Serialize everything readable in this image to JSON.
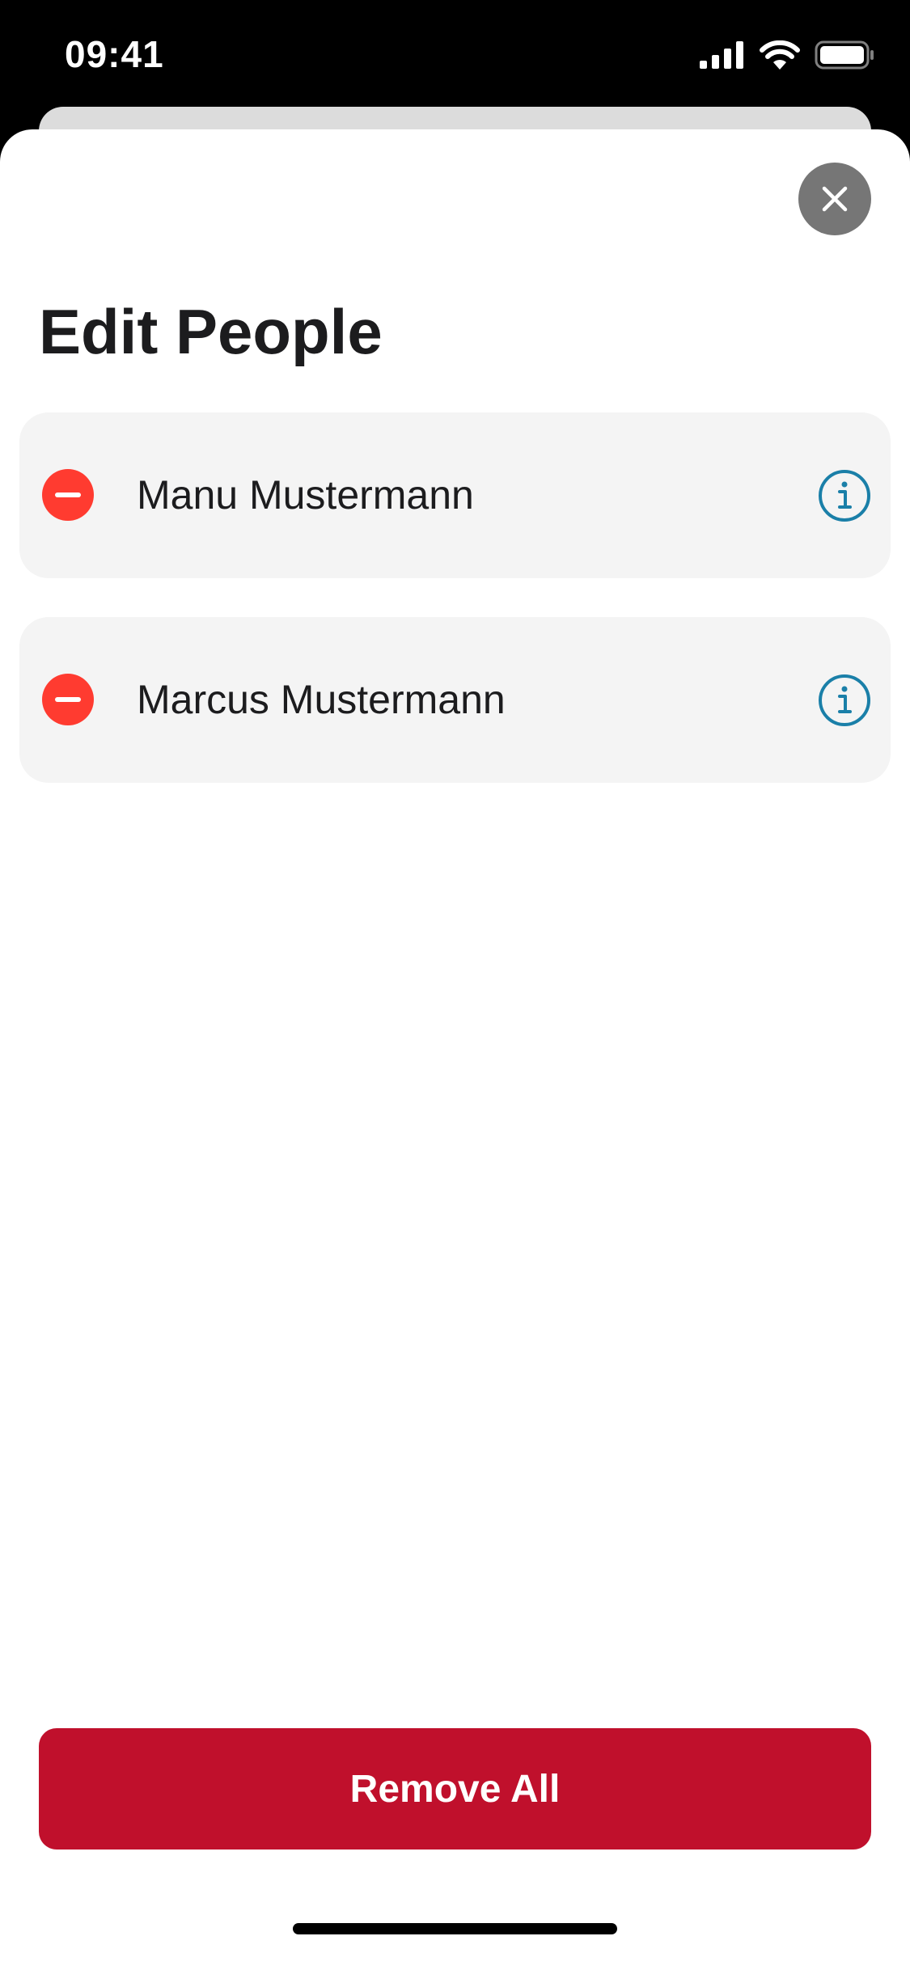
{
  "status_bar": {
    "time": "09:41",
    "icons": [
      "cellular-signal-icon",
      "wifi-icon",
      "battery-icon"
    ]
  },
  "sheet": {
    "title": "Edit People",
    "close_icon": "close-icon"
  },
  "people": [
    {
      "name": "Manu Mustermann"
    },
    {
      "name": "Marcus Mustermann"
    }
  ],
  "actions": {
    "remove_all_label": "Remove All"
  },
  "colors": {
    "destructive": "#ff3b30",
    "info_accent": "#1a7fa8",
    "primary_button": "#c0102c"
  }
}
